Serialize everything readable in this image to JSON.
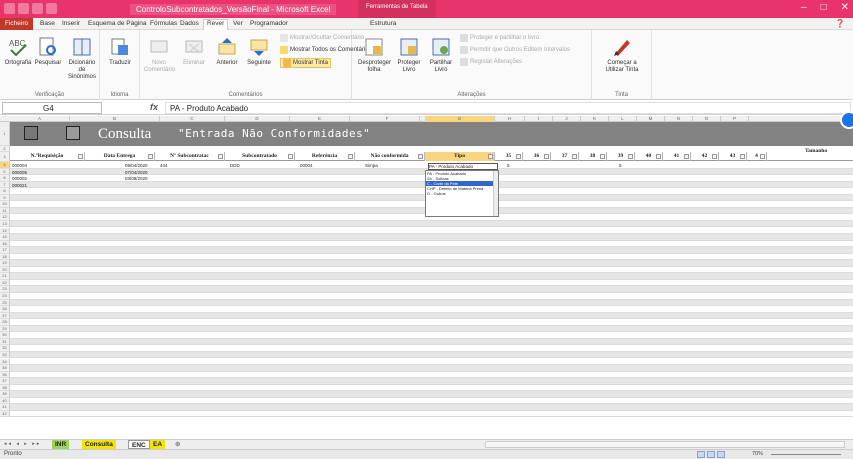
{
  "window": {
    "title": "ControloSubcontratados_VersãoFinal - Microsoft Excel",
    "context_tab": "Ferramentas de Tabela",
    "controls": [
      "–",
      "□",
      "✕"
    ]
  },
  "tabs": [
    "Ficheiro",
    "Base",
    "Inserir",
    "Esquema de Página",
    "Fórmulas",
    "Dados",
    "Rever",
    "Ver",
    "Programador",
    "Estrutura"
  ],
  "active_tab": "Rever",
  "ribbon": {
    "verificacao": {
      "label": "Verificação",
      "ortografia": "Ortografia",
      "pesquisar": "Pesquisar",
      "dicionario": "Dicionário de Sinónimos"
    },
    "idioma": {
      "label": "Idioma",
      "traduzir": "Traduzir"
    },
    "comentarios": {
      "label": "Comentários",
      "novo": "Novo Comentário",
      "eliminar": "Eliminar",
      "anterior": "Anterior",
      "seguinte": "Seguinte",
      "mostrar_ocultar": "Mostrar/Ocultar Comentário",
      "mostrar_todos": "Mostrar Todos os Comentários",
      "mostrar_tinta": "Mostrar Tinta"
    },
    "alteracoes": {
      "label": "Alterações",
      "desproteger_folha": "Desproteger folha",
      "proteger_livro": "Proteger Livro",
      "partilhar_livro": "Partilhar Livro",
      "proteger_partilhar": "Proteger e partilhar o livro",
      "permitir_editar": "Permitir que Outros Editem Intervalos",
      "registar": "Registar Alterações"
    },
    "tinta": {
      "label": "Tinta",
      "comecar": "Começar a Utilizar Tinta"
    }
  },
  "formula_bar": {
    "cell": "G4",
    "fx": "fx",
    "value": "PA - Produto Acabado"
  },
  "columns": [
    "A",
    "B",
    "C",
    "D",
    "E",
    "F",
    "G",
    "H",
    "I",
    "J",
    "K",
    "L",
    "M",
    "N",
    "O",
    "P"
  ],
  "banner": {
    "title": "Consulta",
    "subtitle": "\"Entrada Não Conformidades\""
  },
  "tamanho_label": "Tamanho",
  "headers": [
    "N.ºRequisição",
    "Data Entrega",
    "Nº Subcontratac",
    "Subcontratado",
    "Referência",
    "Não conformida",
    "Tipo",
    "35",
    "36",
    "37",
    "38",
    "39",
    "40",
    "41",
    "42",
    "43",
    "4"
  ],
  "rows": [
    {
      "req": "000004",
      "data": "09/04/2020",
      "sub": "444",
      "subc": "DDD",
      "ref": "00004",
      "nc": "Simpa",
      "tipo": "PA - Produto Acabado",
      "sizes": {
        "35": "5",
        "39": "5"
      }
    },
    {
      "req": "000005",
      "data": "07/04/2020",
      "sub": "",
      "subc": "",
      "ref": "",
      "nc": "",
      "tipo": "",
      "sizes": {}
    },
    {
      "req": "000002",
      "data": "03/09/2020",
      "sub": "",
      "subc": "",
      "ref": "",
      "nc": "",
      "tipo": "",
      "sizes": {}
    },
    {
      "req": "000021",
      "data": "",
      "sub": "",
      "subc": "",
      "ref": "",
      "nc": "",
      "tipo": "",
      "sizes": {}
    }
  ],
  "dropdown_options": [
    "PA - Produto Acabado",
    "Sh - Solinas",
    "C - Corte da Pele",
    "CHP - Defeito de Matéria Prima",
    "O - Outros"
  ],
  "dropdown_selected_index": 2,
  "row_numbers": [
    "1",
    "2",
    "3",
    "4",
    "5",
    "6",
    "7",
    "8",
    "9",
    "10",
    "11",
    "12",
    "13",
    "14",
    "15",
    "16",
    "17",
    "18",
    "19",
    "20",
    "21",
    "22",
    "23",
    "24",
    "25",
    "26",
    "27",
    "28",
    "29",
    "30",
    "31",
    "32",
    "33",
    "34",
    "35",
    "36",
    "37",
    "38",
    "39",
    "40",
    "41",
    "42"
  ],
  "sheets": [
    "INR",
    "Consulta",
    "ENC",
    "EA"
  ],
  "active_sheet": "ENC",
  "status": {
    "ready": "Pronto",
    "zoom": "70%"
  },
  "colors": {
    "titlebar": "#e8336b",
    "banner": "#828282",
    "selected_header": "#f8d57e",
    "sheet_inr": "#9ed35a",
    "sheet_consulta": "#f5e400",
    "sheet_ea": "#f5e400"
  }
}
